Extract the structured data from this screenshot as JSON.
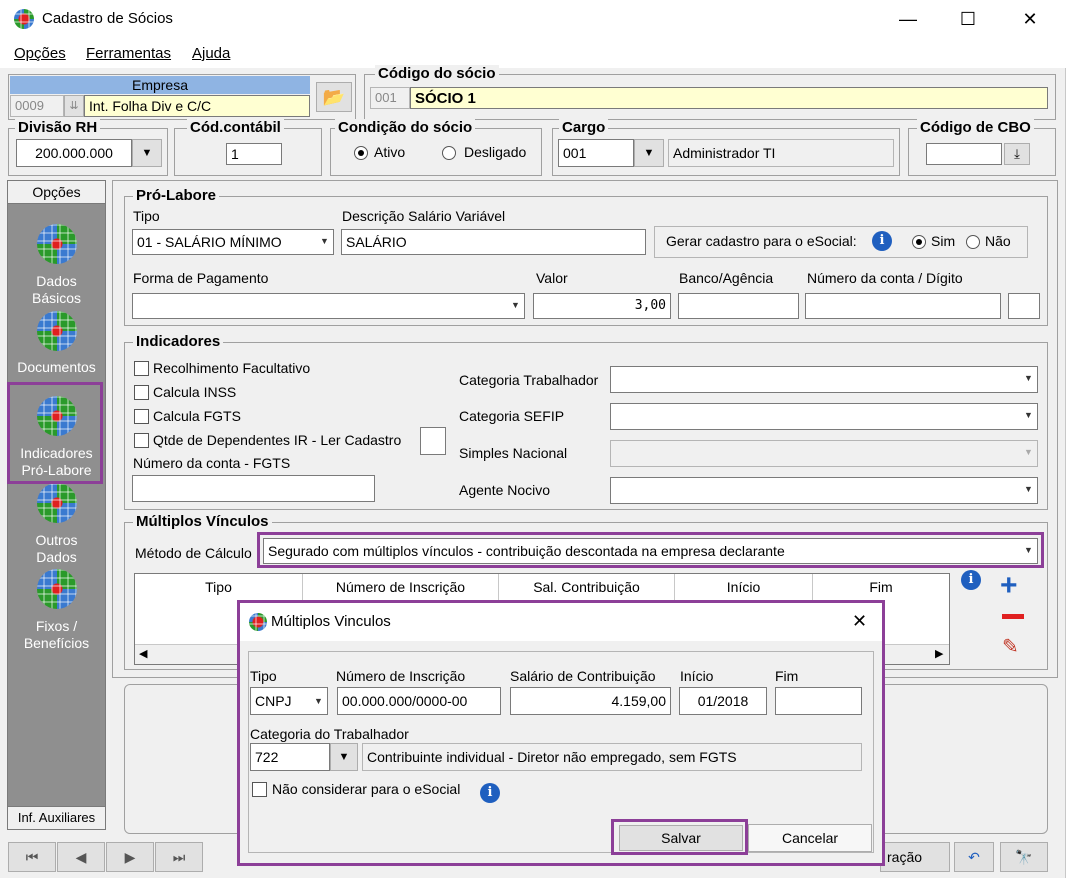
{
  "window": {
    "title": "Cadastro de Sócios",
    "minimize": "—",
    "maximize": "☐",
    "close": "✕"
  },
  "menu": [
    "Opções",
    "Ferramentas",
    "Ajuda"
  ],
  "empresa": {
    "header": "Empresa",
    "code": "0009",
    "name": "Int. Folha Div e C/C"
  },
  "socio": {
    "title": "Código do sócio",
    "code": "001",
    "name": "SÓCIO 1"
  },
  "divisao": {
    "title": "Divisão RH",
    "value": "200.000.000"
  },
  "contabil": {
    "title": "Cód.contábil",
    "value": "1"
  },
  "condicao": {
    "title": "Condição do sócio",
    "ativo": "Ativo",
    "desligado": "Desligado"
  },
  "cargo": {
    "title": "Cargo",
    "code": "001",
    "description": "Administrador TI"
  },
  "cbo": {
    "title": "Código de CBO",
    "value": ""
  },
  "sidebar": {
    "header": "Opções",
    "items": [
      {
        "label1": "Dados",
        "label2": "Básicos"
      },
      {
        "label1": "Documentos",
        "label2": ""
      },
      {
        "label1": "Indicadores",
        "label2": "Pró-Labore"
      },
      {
        "label1": "Outros",
        "label2": "Dados"
      },
      {
        "label1": "Fixos /",
        "label2": "Benefícios"
      }
    ],
    "footer": "Inf. Auxiliares"
  },
  "prolabore": {
    "title": "Pró-Labore",
    "tipo_label": "Tipo",
    "tipo_value": "01 - SALÁRIO MÍNIMO",
    "desc_label": "Descrição Salário Variável",
    "desc_value": "SALÁRIO",
    "esocial_label": "Gerar cadastro para o eSocial:",
    "sim": "Sim",
    "nao": "Não",
    "forma_label": "Forma de Pagamento",
    "forma_value": "",
    "valor_label": "Valor",
    "valor_value": "3,00",
    "banco_label": "Banco/Agência",
    "conta_label": "Número da conta / Dígito"
  },
  "indicadores": {
    "title": "Indicadores",
    "chk1": "Recolhimento Facultativo",
    "chk2": "Calcula INSS",
    "chk3": "Calcula FGTS",
    "chk4": "Qtde de Dependentes IR - Ler Cadastro",
    "fgts_label": "Número da conta - FGTS",
    "cat_trab": "Categoria Trabalhador",
    "cat_sefip": "Categoria SEFIP",
    "simples": "Simples Nacional",
    "agente": "Agente Nocivo"
  },
  "multiplos": {
    "title": "Múltiplos Vínculos",
    "metodo_label": "Método de Cálculo",
    "metodo_value": "Segurado com múltiplos vínculos - contribuição descontada na empresa declarante",
    "columns": [
      "Tipo",
      "Número de Inscrição",
      "Sal. Contribuição",
      "Início",
      "Fim"
    ]
  },
  "dialog": {
    "title": "Múltiplos Vinculos",
    "tipo_label": "Tipo",
    "tipo_value": "CNPJ",
    "inscricao_label": "Número de Inscrição",
    "inscricao_value": "00.000.000/0000-00",
    "salario_label": "Salário de Contribuição",
    "salario_value": "4.159,00",
    "inicio_label": "Início",
    "inicio_value": "01/2018",
    "fim_label": "Fim",
    "fim_value": "",
    "categoria_label": "Categoria do Trabalhador",
    "categoria_code": "722",
    "categoria_desc": "Contribuinte individual - Diretor não empregado, sem FGTS",
    "nao_considerar": "Não considerar para o eSocial",
    "salvar": "Salvar",
    "cancelar": "Cancelar"
  },
  "bottom": {
    "first": "⏮",
    "prev": "◀",
    "next": "▶",
    "last": "⏭",
    "partial": "ração",
    "undo": "↶",
    "find": "🔭"
  },
  "colors": {
    "accent": "#8c3f98",
    "yellow_field": "#ffffd2",
    "sidebar": "#8f8f8f"
  }
}
